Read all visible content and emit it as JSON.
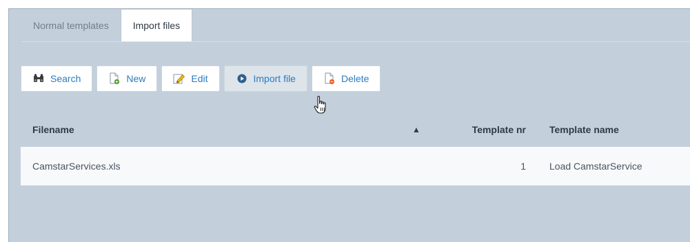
{
  "tabs": [
    {
      "label": "Normal templates",
      "active": false
    },
    {
      "label": "Import files",
      "active": true
    }
  ],
  "toolbar": {
    "search_label": "Search",
    "new_label": "New",
    "edit_label": "Edit",
    "import_label": "Import file",
    "delete_label": "Delete"
  },
  "table": {
    "headers": {
      "filename": "Filename",
      "sort_indicator": "▲",
      "template_nr": "Template nr",
      "template_name": "Template name"
    },
    "rows": [
      {
        "filename": "CamstarServices.xls",
        "template_nr": "1",
        "template_name": "Load CamstarService"
      }
    ]
  },
  "colors": {
    "panel_bg": "#c3d0dc",
    "link_blue": "#2a7bc0",
    "row_bg": "#f7f9fb"
  },
  "icons": {
    "search": "binoculars-icon",
    "new": "document-add-icon",
    "edit": "pencil-icon",
    "import": "play-circle-icon",
    "delete": "document-delete-icon",
    "cursor": "hand-pointer-cursor"
  }
}
